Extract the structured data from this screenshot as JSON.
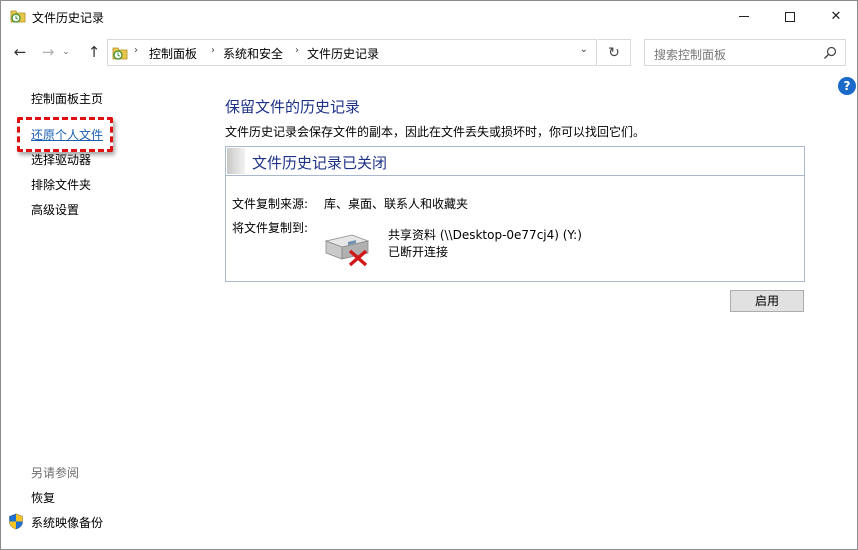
{
  "window": {
    "title": "文件历史记录",
    "minimize": "─",
    "maximize": "☐",
    "close": "✕"
  },
  "nav": {
    "back": "←",
    "forward": "→",
    "history": "⌄",
    "up": "↑"
  },
  "address": {
    "breadcrumbs": [
      "控制面板",
      "系统和安全",
      "文件历史记录"
    ],
    "separator": "›",
    "dropdown": "⌄",
    "refresh": "↻"
  },
  "search": {
    "placeholder": "搜索控制面板"
  },
  "help": "?",
  "sidebar": {
    "home": "控制面板主页",
    "items": [
      "还原个人文件",
      "选择驱动器",
      "排除文件夹",
      "高级设置"
    ],
    "see_also_heading": "另请参阅",
    "see_also": [
      "恢复",
      "系统映像备份"
    ]
  },
  "main": {
    "title": "保留文件的历史记录",
    "description": "文件历史记录会保存文件的副本，因此在文件丢失或损坏时，你可以找回它们。",
    "status": {
      "title": "文件历史记录已关闭",
      "source_label": "文件复制来源:",
      "source_value": "库、桌面、联系人和收藏夹",
      "target_label": "将文件复制到:",
      "drive_name": "共享资料 (\\\\Desktop-0e77cj4) (Y:)",
      "drive_status": "已断开连接"
    },
    "enable_button": "启用"
  },
  "colors": {
    "heading": "#1e3287",
    "link": "#1a5fb4",
    "highlight": "#e01010",
    "help": "#1b6ac9"
  }
}
